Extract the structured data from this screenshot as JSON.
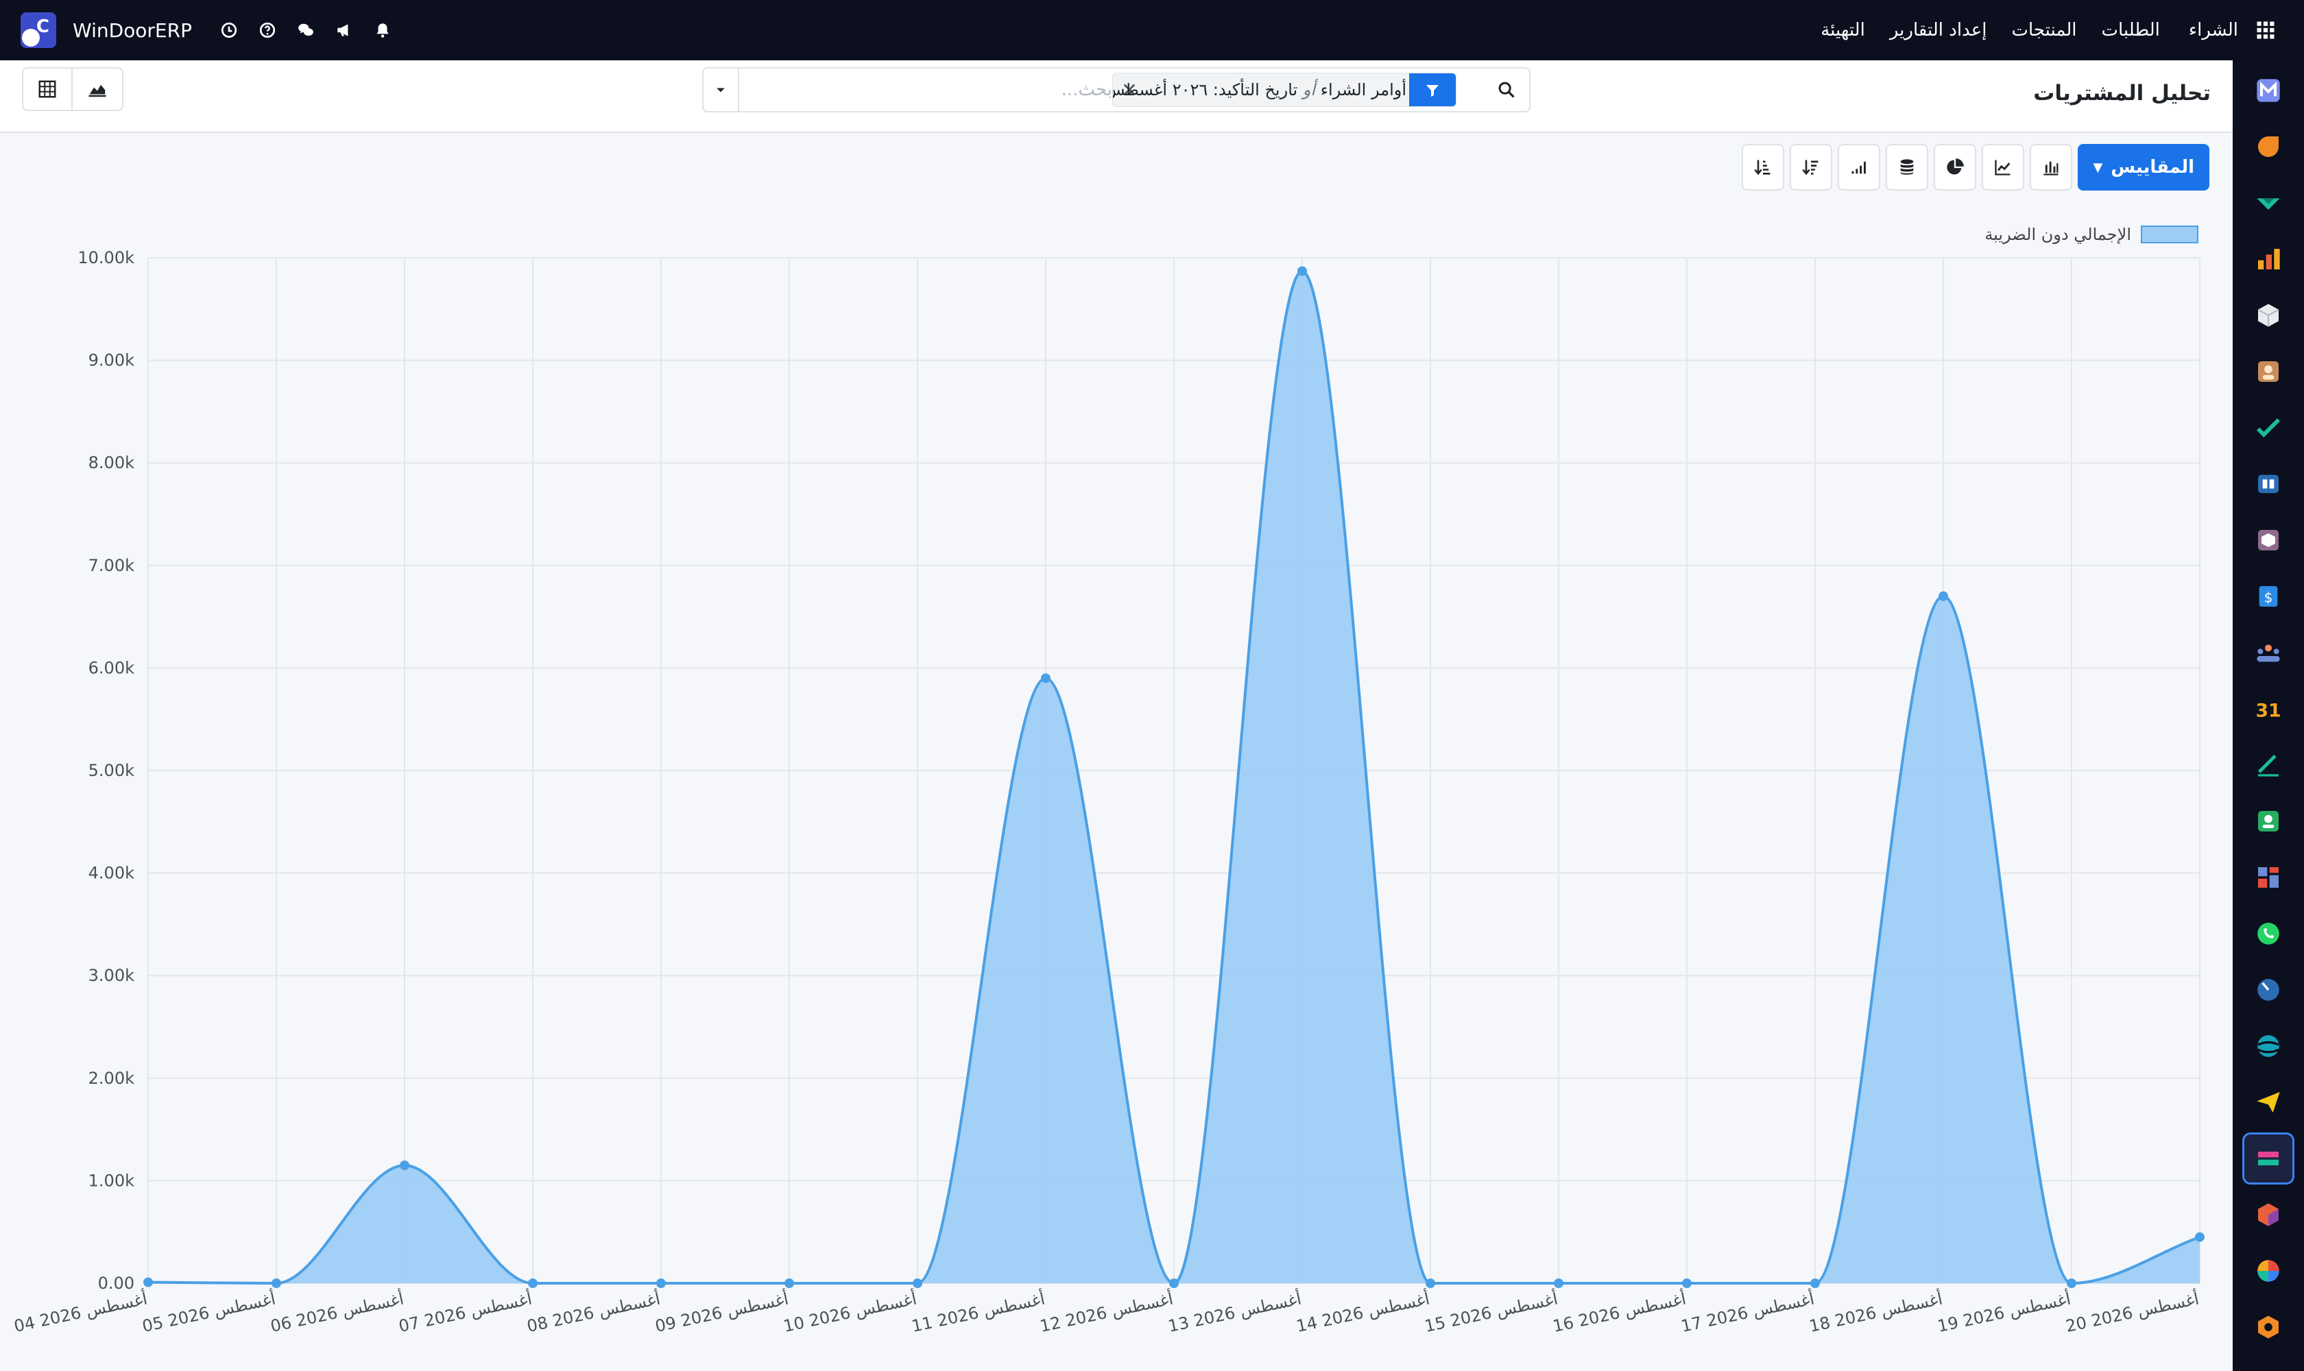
{
  "topbar": {
    "brand": "WinDoorERP",
    "menu": [
      "الشراء",
      "الطلبات",
      "المنتجات",
      "إعداد التقارير",
      "التهيئة"
    ]
  },
  "control": {
    "title": "تحليل المشتريات",
    "search_placeholder": "بحث...",
    "facet": {
      "field1": "أوامر الشراء",
      "separator": "أو",
      "field2": "تاريخ التأكيد: ٢٠٢٦ أغسطس"
    }
  },
  "toolbar": {
    "measures_label": "المقاييس"
  },
  "colors": {
    "accent": "#1a73e8",
    "line": "#4aa0e6",
    "fill": "#9ecdf6",
    "topbar": "#0b0f1e"
  },
  "chart_data": {
    "type": "area",
    "categories": [
      "04 أغسطس 2026",
      "05 أغسطس 2026",
      "06 أغسطس 2026",
      "07 أغسطس 2026",
      "08 أغسطس 2026",
      "09 أغسطس 2026",
      "10 أغسطس 2026",
      "11 أغسطس 2026",
      "12 أغسطس 2026",
      "13 أغسطس 2026",
      "14 أغسطس 2026",
      "15 أغسطس 2026",
      "16 أغسطس 2026",
      "17 أغسطس 2026",
      "18 أغسطس 2026",
      "19 أغسطس 2026",
      "20 أغسطس 2026"
    ],
    "series": [
      {
        "name": "الإجمالي دون الضريبة",
        "values": [
          10,
          0,
          1150,
          0,
          0,
          0,
          0,
          5900,
          0,
          9870,
          0,
          0,
          0,
          0,
          6700,
          0,
          450
        ]
      }
    ],
    "yticks": [
      "0.00",
      "1.00k",
      "2.00k",
      "3.00k",
      "4.00k",
      "5.00k",
      "6.00k",
      "7.00k",
      "8.00k",
      "9.00k",
      "10.00k"
    ],
    "ylim": [
      0,
      10000
    ],
    "grid": true,
    "legend": "top-right"
  }
}
